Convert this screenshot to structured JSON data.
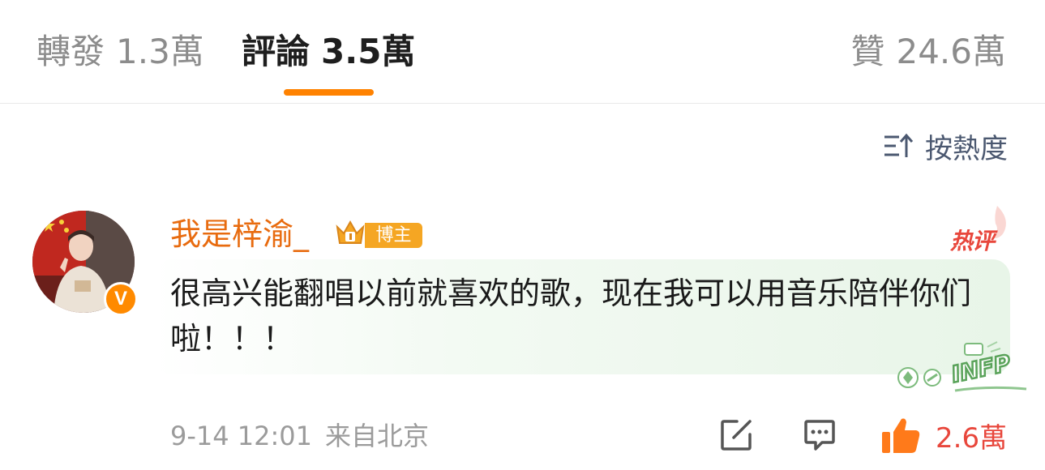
{
  "tabs": {
    "repost": {
      "label": "轉發",
      "count": "1.3萬"
    },
    "comments": {
      "label": "評論",
      "count": "3.5萬",
      "active": true
    },
    "likes": {
      "label": "贊",
      "count": "24.6萬"
    }
  },
  "sort": {
    "label": "按熱度",
    "icon": "sort-icon"
  },
  "comment": {
    "username": "我是梓渝_",
    "role_badge": "博主",
    "hot_tag": "热评",
    "text": "很高兴能翻唱以前就喜欢的歌，现在我可以用音乐陪伴你们啦！！！",
    "decoration_text": "INFP",
    "timestamp": "9-14 12:01",
    "location": "来自北京",
    "like_count": "2.6萬",
    "verified_badge": "V"
  },
  "colors": {
    "accent": "#ff8200",
    "username": "#e86b0f",
    "hot": "#e8473c",
    "muted": "#9b9b9b",
    "sort": "#4b5870"
  }
}
